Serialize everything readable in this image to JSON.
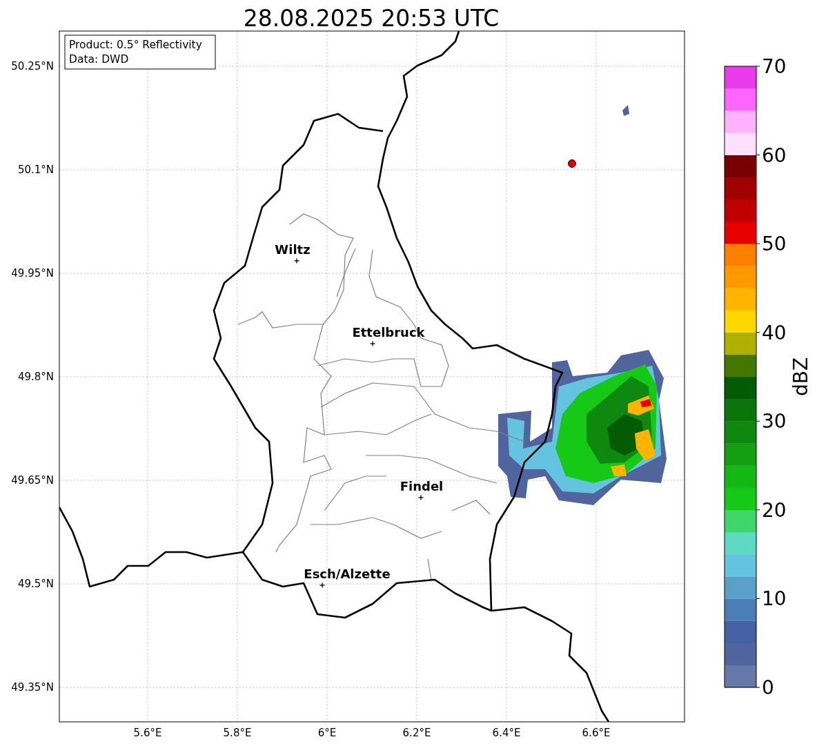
{
  "title": "28.08.2025 20:53 UTC",
  "info_box": [
    "Product: 0.5° Reflectivity",
    "Data: DWD"
  ],
  "latitude_labels": [
    "50.25°N",
    "50.1°N",
    "49.95°N",
    "49.8°N",
    "49.65°N",
    "49.5°N",
    "49.35°N"
  ],
  "longitude_labels": [
    "5.6°E",
    "5.8°E",
    "6°E",
    "6.2°E",
    "6.4°E",
    "6.6°E"
  ],
  "places": [
    {
      "name": "Wiltz"
    },
    {
      "name": "Ettelbruck"
    },
    {
      "name": "Findel"
    },
    {
      "name": "Esch/Alzette"
    }
  ],
  "colorbar": {
    "label": "dBZ",
    "ticks": [
      "70",
      "60",
      "50",
      "40",
      "30",
      "20",
      "10",
      "0"
    ],
    "bins": [
      {
        "color": "#6677aa"
      },
      {
        "color": "#50649e"
      },
      {
        "color": "#4361a4"
      },
      {
        "color": "#4b7db6"
      },
      {
        "color": "#5aa0c8"
      },
      {
        "color": "#64c3de"
      },
      {
        "color": "#5fd9c5"
      },
      {
        "color": "#3ed56b"
      },
      {
        "color": "#16c916"
      },
      {
        "color": "#14b814"
      },
      {
        "color": "#12a012"
      },
      {
        "color": "#0e880e"
      },
      {
        "color": "#0a760a"
      },
      {
        "color": "#035c03"
      },
      {
        "color": "#467500"
      },
      {
        "color": "#b0b000"
      },
      {
        "color": "#ffd700"
      },
      {
        "color": "#ffb400"
      },
      {
        "color": "#ff9900"
      },
      {
        "color": "#ff7f00"
      },
      {
        "color": "#e60000"
      },
      {
        "color": "#c00000"
      },
      {
        "color": "#a00000"
      },
      {
        "color": "#780000"
      },
      {
        "color": "#ffe0ff"
      },
      {
        "color": "#ffb3ff"
      },
      {
        "color": "#ff66ff"
      },
      {
        "color": "#e93be9"
      }
    ]
  }
}
